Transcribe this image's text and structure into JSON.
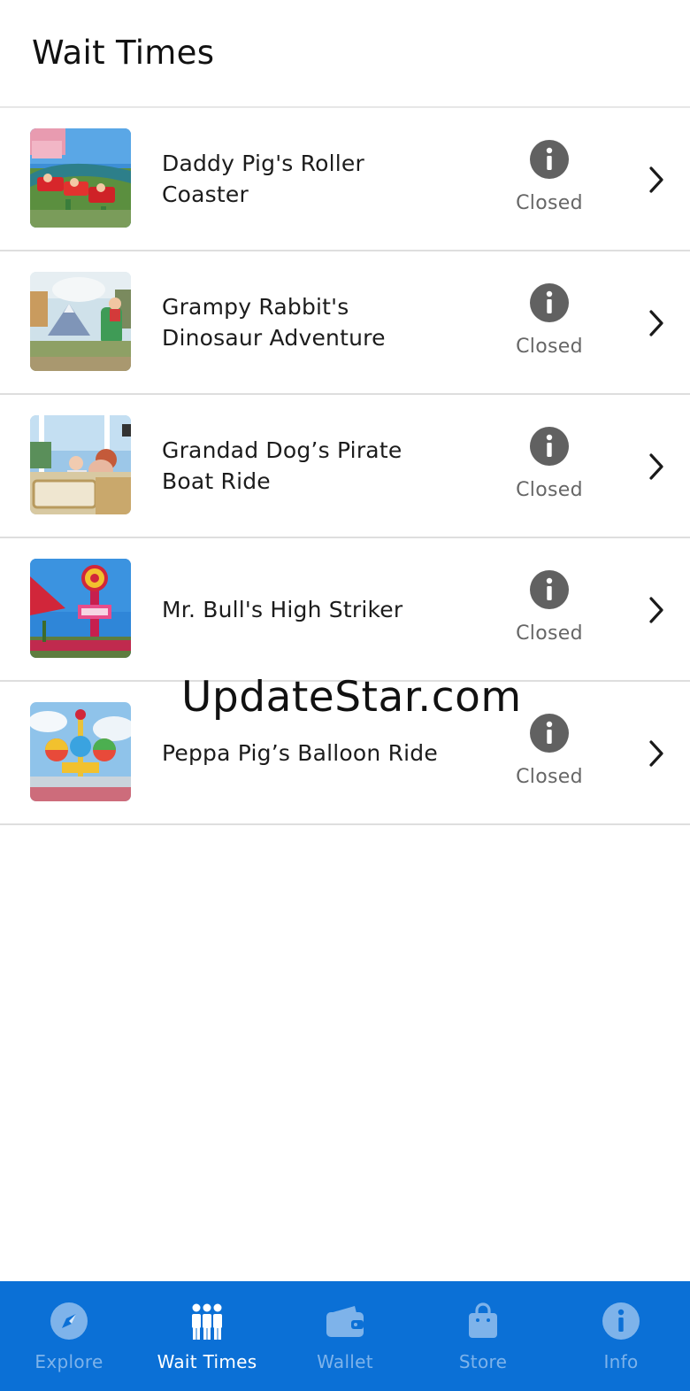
{
  "header": {
    "title": "Wait Times"
  },
  "rides": [
    {
      "name": "Daddy Pig's Roller Coaster",
      "status": "Closed",
      "image": "roller-coaster-photo"
    },
    {
      "name": "Grampy Rabbit's Dinosaur Adventure",
      "status": "Closed",
      "image": "dinosaur-ride-photo"
    },
    {
      "name": "Grandad Dog’s Pirate Boat Ride",
      "status": "Closed",
      "image": "pirate-boat-photo"
    },
    {
      "name": "Mr. Bull's High Striker",
      "status": "Closed",
      "image": "high-striker-photo"
    },
    {
      "name": "Peppa Pig’s Balloon Ride",
      "status": "Closed",
      "image": "balloon-ride-photo"
    }
  ],
  "watermark": "UpdateStar.com",
  "tabbar": {
    "tabs": [
      {
        "label": "Explore",
        "icon": "compass-icon",
        "active": false
      },
      {
        "label": "Wait Times",
        "icon": "people-queue-icon",
        "active": true
      },
      {
        "label": "Wallet",
        "icon": "wallet-icon",
        "active": false
      },
      {
        "label": "Store",
        "icon": "shopping-bag-icon",
        "active": false
      },
      {
        "label": "Info",
        "icon": "info-icon",
        "active": false
      }
    ]
  },
  "colors": {
    "tabbar_bg": "#0b70d6",
    "tab_inactive": "#7eb3ea",
    "tab_active": "#ffffff",
    "status_icon": "#616161"
  }
}
